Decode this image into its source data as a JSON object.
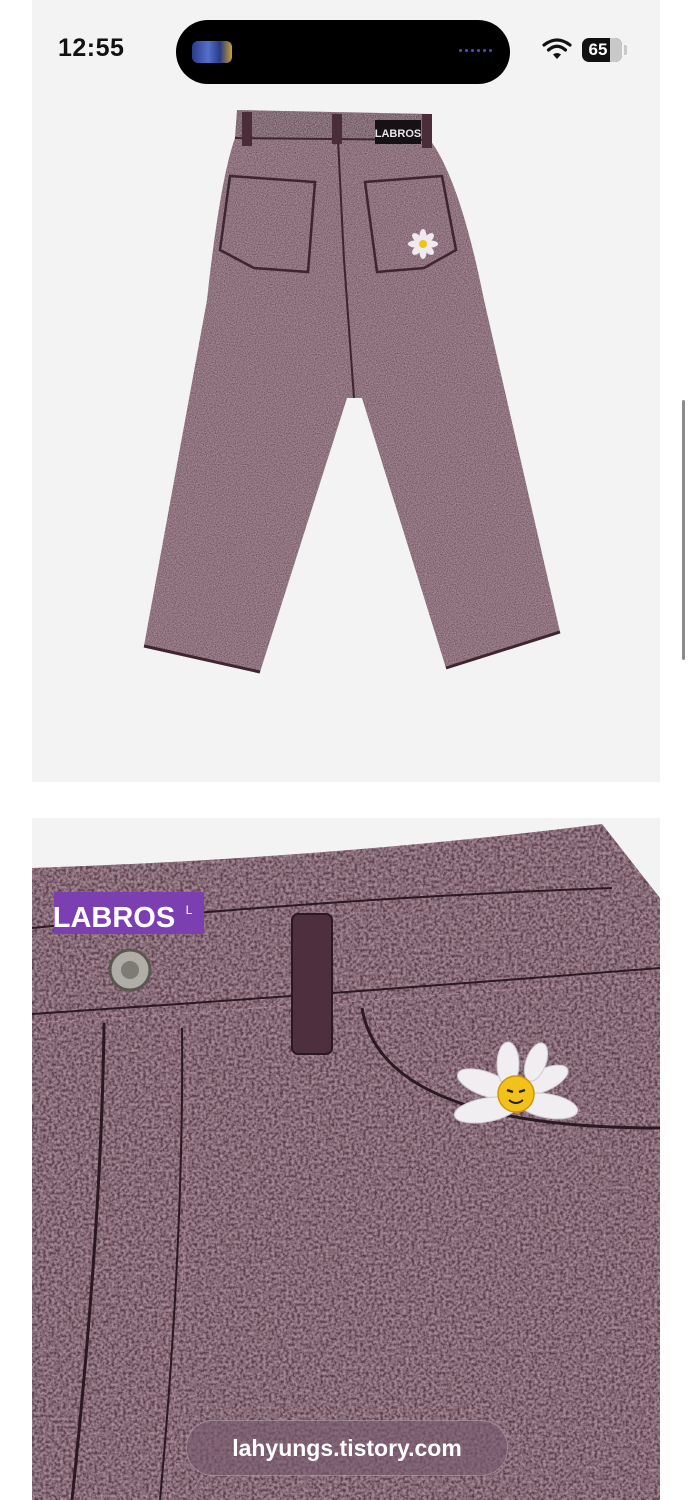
{
  "status_bar": {
    "time": "12:55",
    "battery": "65",
    "icons": [
      "wifi-icon",
      "battery-icon"
    ]
  },
  "products": {
    "photo1": {
      "brand_label": "LABROS"
    },
    "photo2": {
      "brand_label": "LABROS",
      "size_label": "L"
    }
  },
  "colors": {
    "denim": "#6a4452",
    "denim_dark": "#3f2530",
    "label_purple": "#7b3fb2",
    "background": "#f3f3f3"
  },
  "address_bar": {
    "url": "lahyungs.tistory.com"
  }
}
